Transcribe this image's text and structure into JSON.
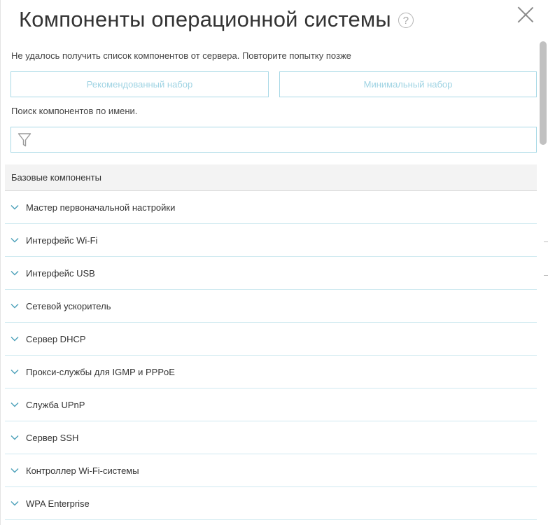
{
  "dialog": {
    "title": "Компоненты операционной системы",
    "help_glyph": "?"
  },
  "error_message": "Не удалось получить список компонентов от сервера. Повторите попытку позже",
  "presets": {
    "recommended_label": "Рекомендованный набор",
    "minimal_label": "Минимальный набор"
  },
  "search": {
    "label": "Поиск компонентов по имени.",
    "value": "",
    "placeholder": ""
  },
  "section": {
    "title": "Базовые компоненты",
    "items": [
      {
        "label": "Мастер первоначальной настройки"
      },
      {
        "label": "Интерфейс Wi-Fi"
      },
      {
        "label": "Интерфейс USB"
      },
      {
        "label": "Сетевой ускоритель"
      },
      {
        "label": "Сервер DHCP"
      },
      {
        "label": "Прокси-службы для IGMP и PPPoE"
      },
      {
        "label": "Служба UPnP"
      },
      {
        "label": "Сервер SSH"
      },
      {
        "label": "Контроллер Wi-Fi-системы"
      },
      {
        "label": "WPA Enterprise"
      }
    ]
  },
  "colors": {
    "accent_border": "#a9d9e6",
    "accent_text": "#9fd3e3",
    "chevron": "#4a9fb8",
    "divider": "#cfe9f0"
  },
  "icons": {
    "help": "question-circle-icon",
    "close": "close-x-icon",
    "filter": "funnel-filter-icon",
    "expand": "chevron-down-icon"
  }
}
